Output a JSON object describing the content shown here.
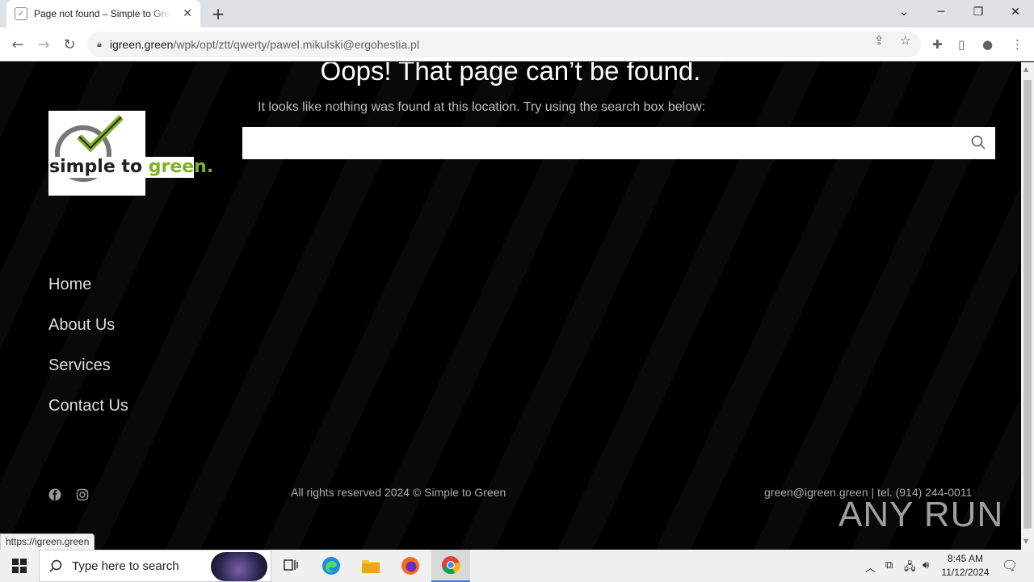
{
  "browser": {
    "tab_title": "Page not found – Simple to Green",
    "tab_close": "✕",
    "new_tab": "+",
    "url_host": "igreen.green",
    "url_path": "/wpk/opt/ztt/qwerty/pawel.mikulski@ergohestia.pl",
    "status_url": "https://igreen.green"
  },
  "page": {
    "heading": "Oops! That page can’t be found.",
    "subtext": "It looks like nothing was found at this location. Try using the search box below:",
    "search_placeholder": "",
    "logo": {
      "word_simple": "simple to ",
      "word_green": "green.",
      "brand_color": "#7fb321"
    },
    "nav": [
      "Home",
      "About Us",
      "Services",
      "Contact Us"
    ],
    "footer": {
      "copyright": "All rights reserved 2024 © Simple to Green",
      "contact": "green@igreen.green | tel. (914) 244-0011"
    },
    "social_icons": [
      "facebook-icon",
      "instagram-icon"
    ]
  },
  "watermark": "ANY RUN",
  "taskbar": {
    "search_label": "Type here to search",
    "time": "8:45 AM",
    "date": "11/12/2024"
  }
}
